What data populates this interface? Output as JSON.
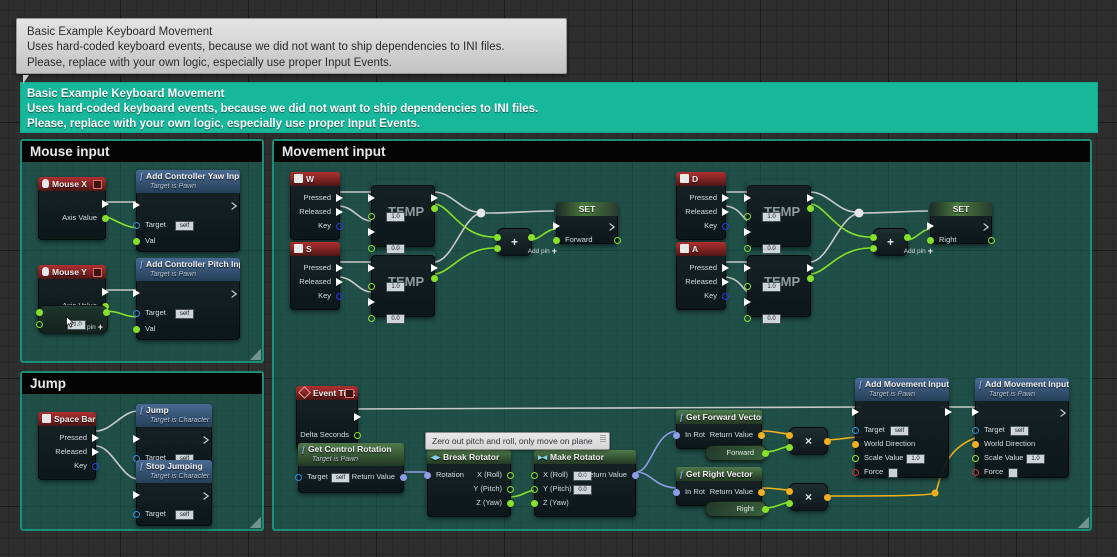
{
  "tooltip": {
    "lines": [
      "Basic Example Keyboard Movement",
      "Uses hard-coded keyboard events, because we did not want to ship dependencies to INI files.",
      "Please, replace with your own logic, especially use proper Input Events."
    ]
  },
  "banner": {
    "lines": [
      "Basic Example Keyboard Movement",
      "Uses hard-coded keyboard events, because we did not want to ship dependencies to INI files.",
      "Please, replace with your own logic, especially use proper Input Events."
    ]
  },
  "comments": {
    "mouse_input": "Mouse input",
    "movement_input": "Movement input",
    "jump": "Jump"
  },
  "sticky_note": "Zero out pitch and roll, only move on plane",
  "labels": {
    "pressed": "Pressed",
    "released": "Released",
    "key": "Key",
    "axis_value": "Axis Value",
    "target": "Target",
    "self": "self",
    "val": "Val",
    "target_is_pawn": "Target is Pawn",
    "target_is_character": "Target is Character",
    "delta_seconds": "Delta Seconds",
    "return_value": "Return Value",
    "rotation": "Rotation",
    "x_roll": "X (Roll)",
    "y_pitch": "Y (Pitch)",
    "z_yaw": "Z (Yaw)",
    "in_rot": "In Rot",
    "world_direction": "World Direction",
    "scale_value": "Scale Value",
    "force": "Force",
    "forward": "Forward",
    "right": "Right",
    "addpin": "Add pin",
    "set": "SET"
  },
  "values": {
    "one": "1.0",
    "zero": "0.0",
    "neg_one": "-1.0",
    "scale": "1.0"
  },
  "nodes": {
    "mouse_x": "Mouse X",
    "mouse_y": "Mouse Y",
    "add_controller_yaw": "Add Controller Yaw Input",
    "add_controller_pitch": "Add Controller Pitch Input",
    "key_w": "W",
    "key_s": "S",
    "key_d": "D",
    "key_a": "A",
    "space_bar": "Space Bar",
    "jump": "Jump",
    "stop_jumping": "Stop Jumping",
    "event_tick": "Event Tick",
    "get_control_rotation": "Get Control Rotation",
    "break_rotator": "Break Rotator",
    "make_rotator": "Make Rotator",
    "get_forward_vector": "Get Forward Vector",
    "get_right_vector": "Get Right Vector",
    "add_movement_input": "Add Movement Input",
    "temp": "TEMP"
  },
  "colors": {
    "banner_teal": "#17b79c",
    "comment_fill": "rgba(17,122,107,0.44)",
    "event_red": "#b03030",
    "function_blue": "#4a6a94",
    "pure_green": "#4f7a4b",
    "exec_white": "#ffffff",
    "float_green": "#87e02a",
    "vector_yellow": "#f2b01e",
    "object_blue": "#2f8fd8",
    "rotator_lavender": "#8f9de8",
    "bool_red": "#d23a3a",
    "key_blue": "#2040e8"
  }
}
